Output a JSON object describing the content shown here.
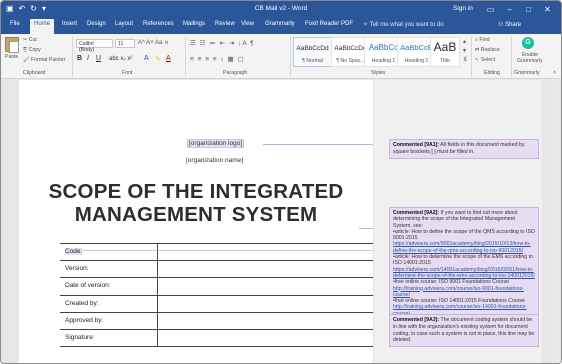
{
  "titlebar": {
    "title": "CB Mail v2  -  Word",
    "signin": "Sign in"
  },
  "tabs": [
    "File",
    "Home",
    "Insert",
    "Design",
    "Layout",
    "References",
    "Mailings",
    "Review",
    "View",
    "Grammarly",
    "Foxit Reader PDF"
  ],
  "active_tab": "Home",
  "tell_me": "Tell me what you want to do",
  "share": "Share",
  "ribbon": {
    "clipboard": {
      "paste": "Paste",
      "cut": "Cut",
      "copy": "Copy",
      "format_painter": "Format Painter",
      "label": "Clipboard"
    },
    "font": {
      "family": "Calibri (Body)",
      "size": "11",
      "label": "Font"
    },
    "paragraph": {
      "label": "Paragraph"
    },
    "styles": {
      "items": [
        {
          "sample": "AaBbCcDd",
          "name": "¶ Normal"
        },
        {
          "sample": "AaBbCcDd",
          "name": "¶ No Spac..."
        },
        {
          "sample": "AaBbCc",
          "name": "Heading 1"
        },
        {
          "sample": "AaBbCcE",
          "name": "Heading 2"
        },
        {
          "sample": "AaB",
          "name": "Title"
        }
      ],
      "label": "Styles"
    },
    "editing": {
      "find": "Find",
      "replace": "Replace",
      "select": "Select",
      "label": "Editing"
    },
    "grammarly": {
      "enable_1": "Enable",
      "enable_2": "Grammarly",
      "label": "Grammarly"
    }
  },
  "document": {
    "logo_placeholder": "[organization logo]",
    "name_placeholder": "[organization name]",
    "title_line1": "SCOPE OF THE INTEGRATED",
    "title_line2": "MANAGEMENT SYSTEM",
    "table_rows": [
      "Code:",
      "Version:",
      "Date of version:",
      "Created by:",
      "Approved by:",
      "Signature:"
    ]
  },
  "comments": {
    "c1": {
      "author": "Commented [9A1]:",
      "text": "All fields in this document marked by square brackets [ ] must be filled in."
    },
    "c2": {
      "author": "Commented [9A2]:",
      "text": "If you want to find out more about determining the scope of the Integrated Management System, see:",
      "b1": "•article: How to define the scope of the QMS according to ISO 9001:2015",
      "l1": "https://advisera.com/9001academy/blog/2015/10/13/how-to-define-the-scope-of-the-qms-according-to-iso-90012015/",
      "b2": "•article: How to determine the scope of the EMS according to ISO 14001:2015",
      "l2": "https://advisera.com/14001academy/blog/2016/02/01/how-to-determine-the-scope-of-the-ems-according-to-iso-140012015/",
      "b3": "•free online course: ISO 9001 Foundations Course",
      "l3": "http://training.advisera.com/course/iso-9001-foundations-course/",
      "b4": "•free online course: ISO 14001:2015 Foundations Course",
      "l4": "http://training.advisera.com/course/iso-14001-foundations-course/"
    },
    "c3": {
      "author": "Commented [9A3]:",
      "text": "The document coding system should be in line with the organization's existing system for document coding; in case such a system is not in place, this line may be deleted."
    }
  }
}
